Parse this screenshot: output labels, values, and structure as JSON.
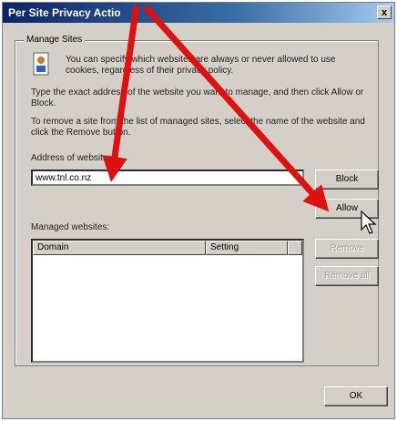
{
  "window": {
    "title": "Per Site Privacy Actio",
    "close_symbol": "x"
  },
  "group": {
    "label": "Manage Sites",
    "intro": "You can specify which websites are always or never allowed to use cookies, regardless of their privacy policy.",
    "type_instructions": "Type the exact address of the website you want to manage, and then click Allow or Block.",
    "remove_instructions": "To remove a site from the list of managed sites, select the name of the website and click the Remove button."
  },
  "address": {
    "label": "Address of website:",
    "value": "www.tnl.co.nz"
  },
  "buttons": {
    "block": "Block",
    "allow": "Allow",
    "remove": "Remove",
    "remove_all": "Remove all",
    "ok": "OK"
  },
  "managed": {
    "label": "Managed websites:",
    "columns": [
      "Domain",
      "Setting",
      ""
    ]
  },
  "colors": {
    "arrow": "#e01010",
    "title_bar": "#0a246a",
    "face": "#d4d0c8"
  },
  "icons": {
    "info": "info-icon",
    "close": "close-icon",
    "cursor": "mouse-cursor-icon",
    "arrow": "red-arrow-annotation"
  }
}
